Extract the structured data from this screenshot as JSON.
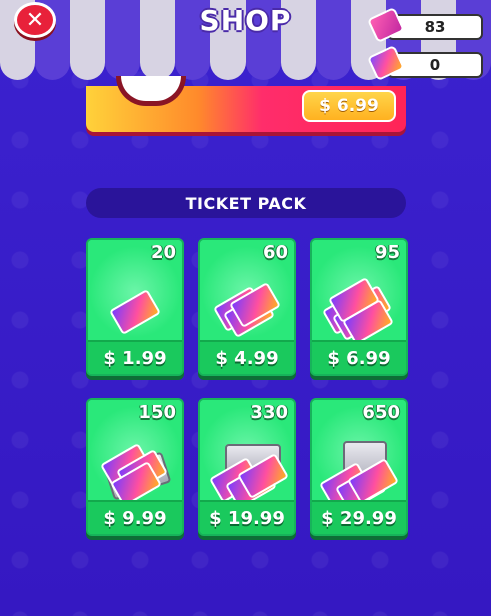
{
  "header": {
    "title": "SHOP",
    "close_icon": "close-icon"
  },
  "currencies": [
    {
      "icon": "pink-gem-ticket-icon",
      "value": "83"
    },
    {
      "icon": "rainbow-ticket-icon",
      "value": "0"
    }
  ],
  "top_offer": {
    "price": "$ 6.99"
  },
  "section": {
    "title": "TICKET PACK"
  },
  "packs": [
    {
      "count": "20",
      "price": "$ 1.99",
      "art": "single-ticket"
    },
    {
      "count": "60",
      "price": "$ 4.99",
      "art": "ticket-stack-small"
    },
    {
      "count": "95",
      "price": "$ 6.99",
      "art": "ticket-stack-medium"
    },
    {
      "count": "150",
      "price": "$ 9.99",
      "art": "ticket-tray"
    },
    {
      "count": "330",
      "price": "$ 19.99",
      "art": "ticket-briefcase"
    },
    {
      "count": "650",
      "price": "$ 29.99",
      "art": "ticket-chest"
    }
  ],
  "colors": {
    "background": "#3a1fc9",
    "card": "#2ae87a",
    "close": "#e8213a",
    "banner": "#ff2457"
  }
}
